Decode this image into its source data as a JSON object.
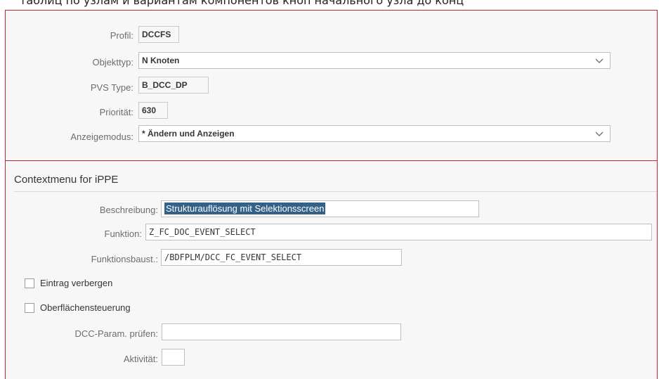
{
  "caption": "таблиц по узлам и вариантам компонентов кноп начального узла до конц",
  "header": {
    "profil": {
      "label": "Profil:",
      "value": "DCCFS"
    },
    "objekttyp": {
      "label": "Objekttyp:",
      "value": "N Knoten"
    },
    "pvs_type": {
      "label": "PVS Type:",
      "value": "B_DCC_DP"
    },
    "prioritaet": {
      "label": "Priorität:",
      "value": "630"
    },
    "anzeigemodus": {
      "label": "Anzeigemodus:",
      "value": "* Ändern und Anzeigen"
    }
  },
  "context_section": {
    "title": "Contextmenu for iPPE",
    "beschreibung": {
      "label": "Beschreibung:",
      "value": "Strukturauflösung mit Selektionsscreen"
    },
    "funktion": {
      "label": "Funktion:",
      "value": "Z_FC_DOC_EVENT_SELECT"
    },
    "funktionsbaust": {
      "label": "Funktionsbaust.:",
      "value": "/BDFPLM/DCC_FC_EVENT_SELECT"
    },
    "eintrag_verbergen": {
      "label": "Eintrag verbergen",
      "checked": false
    },
    "oberflaechensteuerung": {
      "label": "Oberflächensteuerung",
      "checked": false
    },
    "dcc_param": {
      "label": "DCC-Param. prüfen:",
      "value": ""
    },
    "aktivitaet": {
      "label": "Aktivität:",
      "value": ""
    }
  },
  "icons": {
    "dropdown": "chevron-down-icon"
  },
  "colors": {
    "selection": "#346187",
    "frame_border": "#c0282d"
  }
}
